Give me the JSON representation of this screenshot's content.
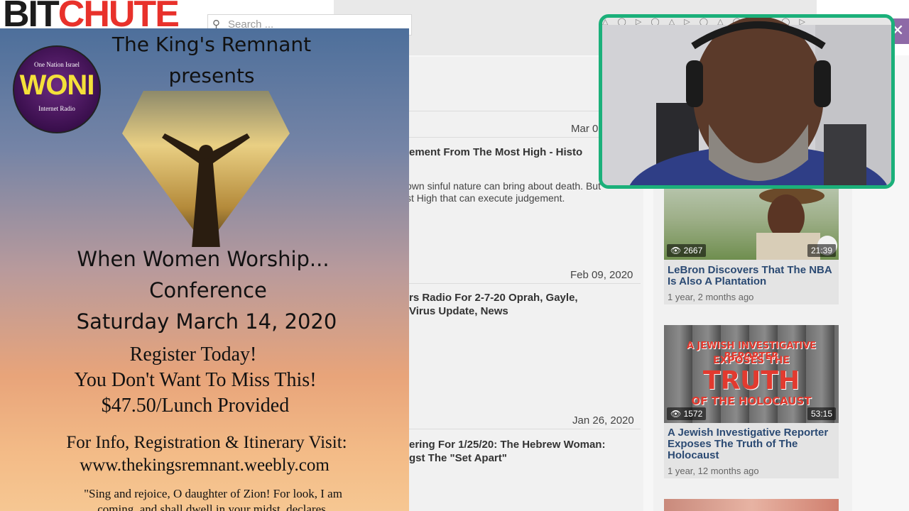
{
  "site": {
    "logo_part1": "BIT",
    "logo_part2": "CHUTE",
    "search_placeholder": "Search ...",
    "close_glyph": "✕"
  },
  "videos": [
    {
      "date": "Mar 0",
      "title": "ement From The Most High - Histo",
      "desc": "own sinful nature can bring about death. But\nst High that can execute judgement."
    },
    {
      "date": "Feb 09, 2020",
      "title": "rs Radio For 2-7-20 Oprah, Gayle,\nVirus Update, News",
      "desc": ""
    },
    {
      "date": "Jan 26, 2020",
      "title": "ering For 1/25/20: The Hebrew Woman:\ngst The \"Set Apart\"",
      "desc": ""
    }
  ],
  "sidebar_cards": [
    {
      "views": "2667",
      "duration": "21:39",
      "title": "LeBron Discovers That The NBA Is Also A Plantation",
      "age": "1 year, 2 months ago",
      "thumb_text": ""
    },
    {
      "views": "1572",
      "duration": "53:15",
      "title": "A Jewish Investigative Reporter Exposes The Truth of The Holocaust",
      "age": "1 year, 12 months ago",
      "thumb_text_1": "A JEWISH INVESTIGATIVE REPORTER",
      "thumb_text_2": "EXPOSES THE",
      "thumb_text_3": "TRUTH",
      "thumb_text_4": "OF THE HOLOCAUST"
    }
  ],
  "flyer": {
    "badge_top": "One Nation Israel",
    "badge_main": "WONI",
    "badge_bottom": "Internet Radio",
    "presenter_line1": "The King's Remnant",
    "presenter_line2": "presents",
    "title_line1": "When Women Worship...",
    "title_line2": "Conference",
    "date": "Saturday March 14, 2020",
    "register": "Register Today!",
    "dont_miss": "You Don't Want To Miss This!",
    "price": "$47.50/Lunch Provided",
    "info": "For Info, Registration & Itinerary Visit:",
    "url": "www.thekingsremnant.weebly.com",
    "quote_line1": "\"Sing and rejoice, O daughter of Zion! For look, I am",
    "quote_line2": "coming, and shall dwell in your midst, declares"
  },
  "colors": {
    "accent_red": "#e8312b",
    "cam_border": "#1bb07a",
    "link_blue": "#2b4a73"
  }
}
